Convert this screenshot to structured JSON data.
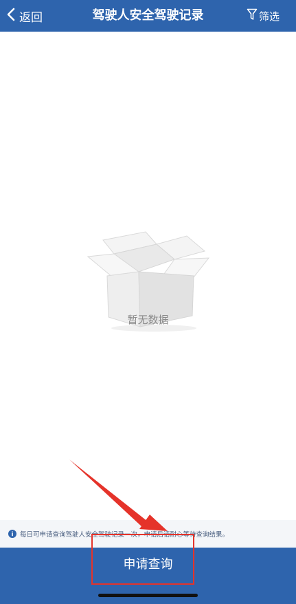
{
  "header": {
    "back_label": "返回",
    "title": "驾驶人安全驾驶记录",
    "filter_label": "筛选",
    "icons": {
      "back": "chevron-left-icon",
      "filter": "funnel-icon"
    }
  },
  "main": {
    "empty_icon": "empty-box-icon",
    "empty_text": "暂无数据"
  },
  "notice": {
    "icon": "info-icon",
    "text": "每日可申请查询驾驶人安全驾驶记录一次，申请后请耐心等待查询结果。"
  },
  "footer": {
    "apply_label": "申请查询"
  },
  "colors": {
    "brand": "#2e64ad",
    "annotation": "#e5332a",
    "empty_text": "#8a8a8a",
    "notice_text": "#4a5f80"
  }
}
